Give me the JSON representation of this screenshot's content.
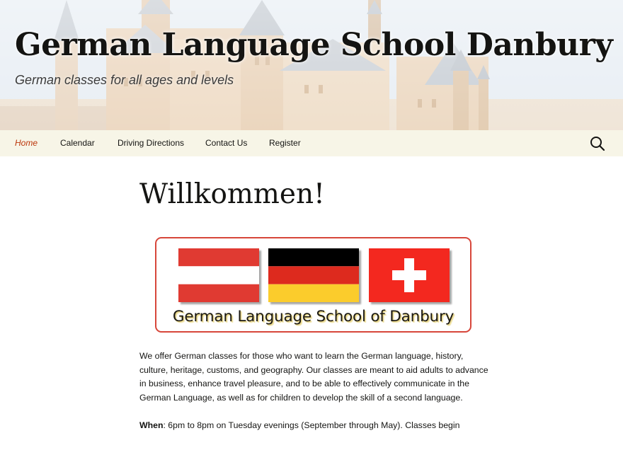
{
  "header": {
    "site_title": "German Language School Danbury",
    "site_description": "German classes for all ages and levels"
  },
  "nav": {
    "items": [
      {
        "label": "Home",
        "current": true
      },
      {
        "label": "Calendar",
        "current": false
      },
      {
        "label": "Driving Directions",
        "current": false
      },
      {
        "label": "Contact Us",
        "current": false
      },
      {
        "label": "Register",
        "current": false
      }
    ],
    "search_icon": "search-icon"
  },
  "page": {
    "title": "Willkommen!",
    "banner": {
      "caption": "German Language School of Danbury",
      "flags": [
        "austria-flag",
        "germany-flag",
        "switzerland-flag"
      ]
    },
    "intro": "We offer German classes for those who want to learn the German language, history, culture, heritage, customs, and geography. Our classes are meant to aid adults to advance in business, enhance travel pleasure, and to be able to effectively communicate in the German Language, as well as for children to develop the skill of a second language.",
    "when_label": "When",
    "when_text": ": 6pm to 8pm on Tuesday evenings (September through May). Classes begin"
  },
  "colors": {
    "navbar_bg": "#f7f5e7",
    "nav_current": "#bc360a",
    "banner_border": "#d7463a",
    "austria_red": "#e03a32",
    "germany_black": "#000000",
    "germany_red": "#dd2a1e",
    "germany_gold": "#fbcc2c",
    "swiss_red": "#f3281f"
  }
}
